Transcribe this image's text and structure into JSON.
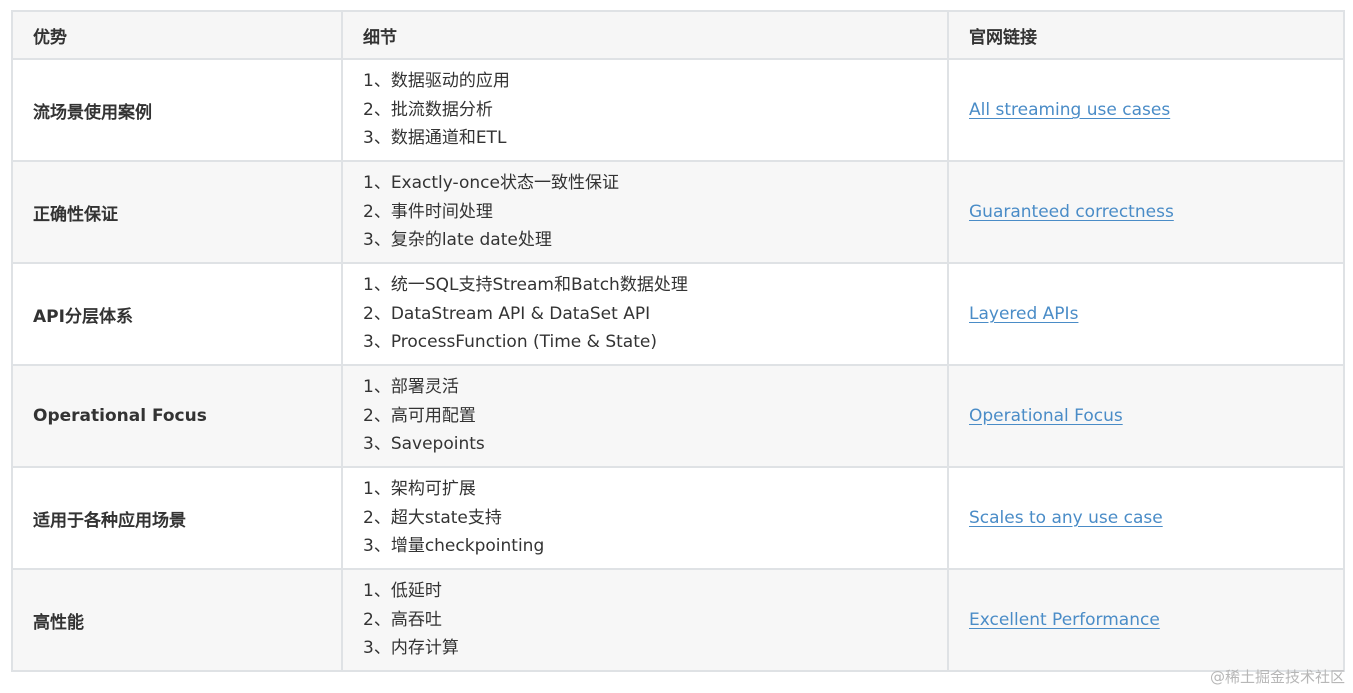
{
  "header": {
    "col_advantage": "优势",
    "col_detail": "细节",
    "col_link": "官网链接"
  },
  "rows": [
    {
      "advantage": "流场景使用案例",
      "details": [
        "1、数据驱动的应用",
        "2、批流数据分析",
        "3、数据通道和ETL"
      ],
      "link": "All streaming use cases"
    },
    {
      "advantage": "正确性保证",
      "details": [
        "1、Exactly-once状态一致性保证",
        "2、事件时间处理",
        "3、复杂的late date处理"
      ],
      "link": "Guaranteed correctness"
    },
    {
      "advantage": "API分层体系",
      "details": [
        "1、统一SQL支持Stream和Batch数据处理",
        "2、DataStream API & DataSet API",
        "3、ProcessFunction (Time & State)"
      ],
      "link": "Layered APIs"
    },
    {
      "advantage": "Operational Focus",
      "details": [
        "1、部署灵活",
        "2、高可用配置",
        "3、Savepoints"
      ],
      "link": "Operational Focus"
    },
    {
      "advantage": "适用于各种应用场景",
      "details": [
        "1、架构可扩展",
        "2、超大state支持",
        "3、增量checkpointing"
      ],
      "link": "Scales to any use case"
    },
    {
      "advantage": "高性能",
      "details": [
        "1、低延时",
        "2、高吞吐",
        "3、内存计算"
      ],
      "link": "Excellent Performance"
    }
  ],
  "watermark": "@稀土掘金技术社区",
  "colors": {
    "link": "#4a8cc7",
    "border": "#dfe2e5",
    "header_bg": "#f6f6f6",
    "stripe_bg": "#f7f7f7"
  }
}
